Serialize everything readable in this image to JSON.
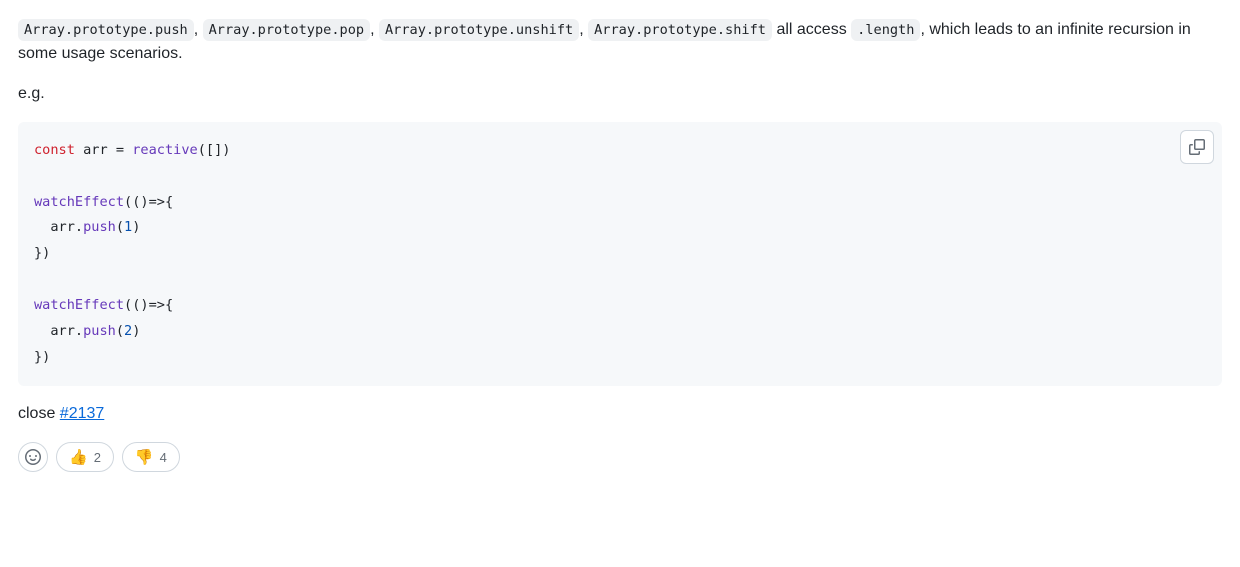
{
  "description": {
    "codeSpans": [
      "Array.prototype.push",
      "Array.prototype.pop",
      "Array.prototype.unshift",
      "Array.prototype.shift"
    ],
    "textAfterSpans": " all access ",
    "lengthCode": ".length",
    "trailing": ", which leads to an infinite recursion in some usage scenarios."
  },
  "eg": "e.g.",
  "code": {
    "tokens": {
      "const": "const",
      "arr": " arr ",
      "eq": "=",
      "sp": " ",
      "reactive": "reactive",
      "emptyArr": "([])",
      "watchEffect": "watchEffect",
      "arrowOpen": "(()=>{",
      "indent": "  arr.",
      "push": "push",
      "open": "(",
      "one": "1",
      "two": "2",
      "close": ")",
      "braceClose": "})"
    }
  },
  "closeText": "close ",
  "issueRef": "#2137",
  "reactions": {
    "thumbsUp": {
      "emoji": "👍",
      "count": "2"
    },
    "thumbsDown": {
      "emoji": "👎",
      "count": "4"
    }
  }
}
